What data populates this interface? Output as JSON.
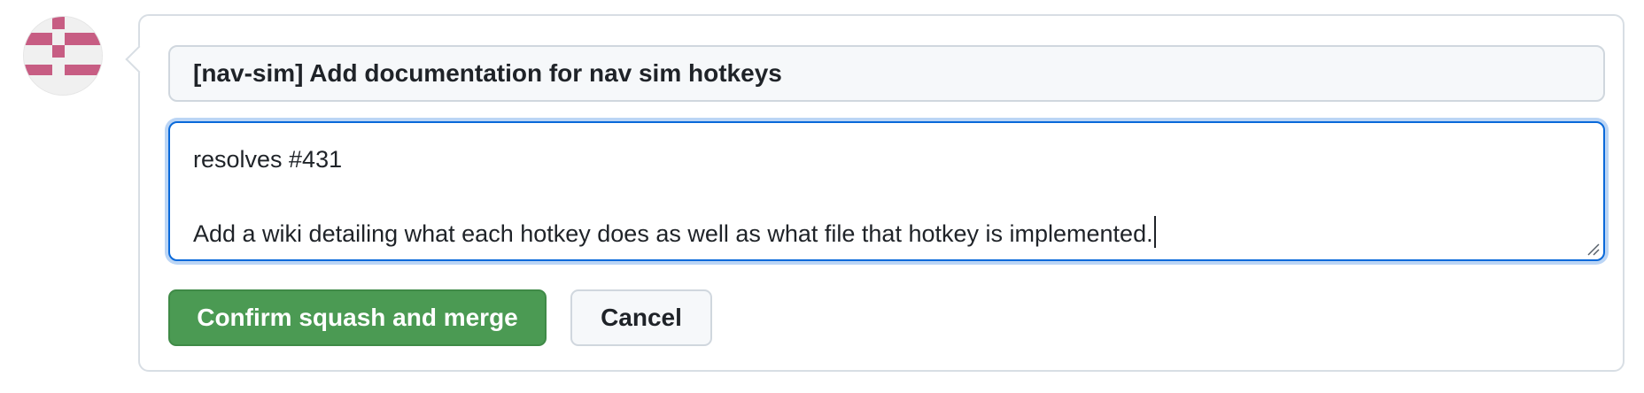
{
  "commit": {
    "title": "[nav-sim] Add documentation for nav sim hotkeys",
    "message_lines": [
      "resolves #431",
      "",
      "Add a wiki detailing what each hotkey does as well as what file that hotkey is implemented."
    ]
  },
  "buttons": {
    "confirm_label": "Confirm squash and merge",
    "cancel_label": "Cancel"
  },
  "avatar": {
    "icon": "identicon",
    "color": "#c75d83"
  },
  "colors": {
    "confirm_bg": "#4b9a53",
    "focus_border": "#0969da"
  }
}
